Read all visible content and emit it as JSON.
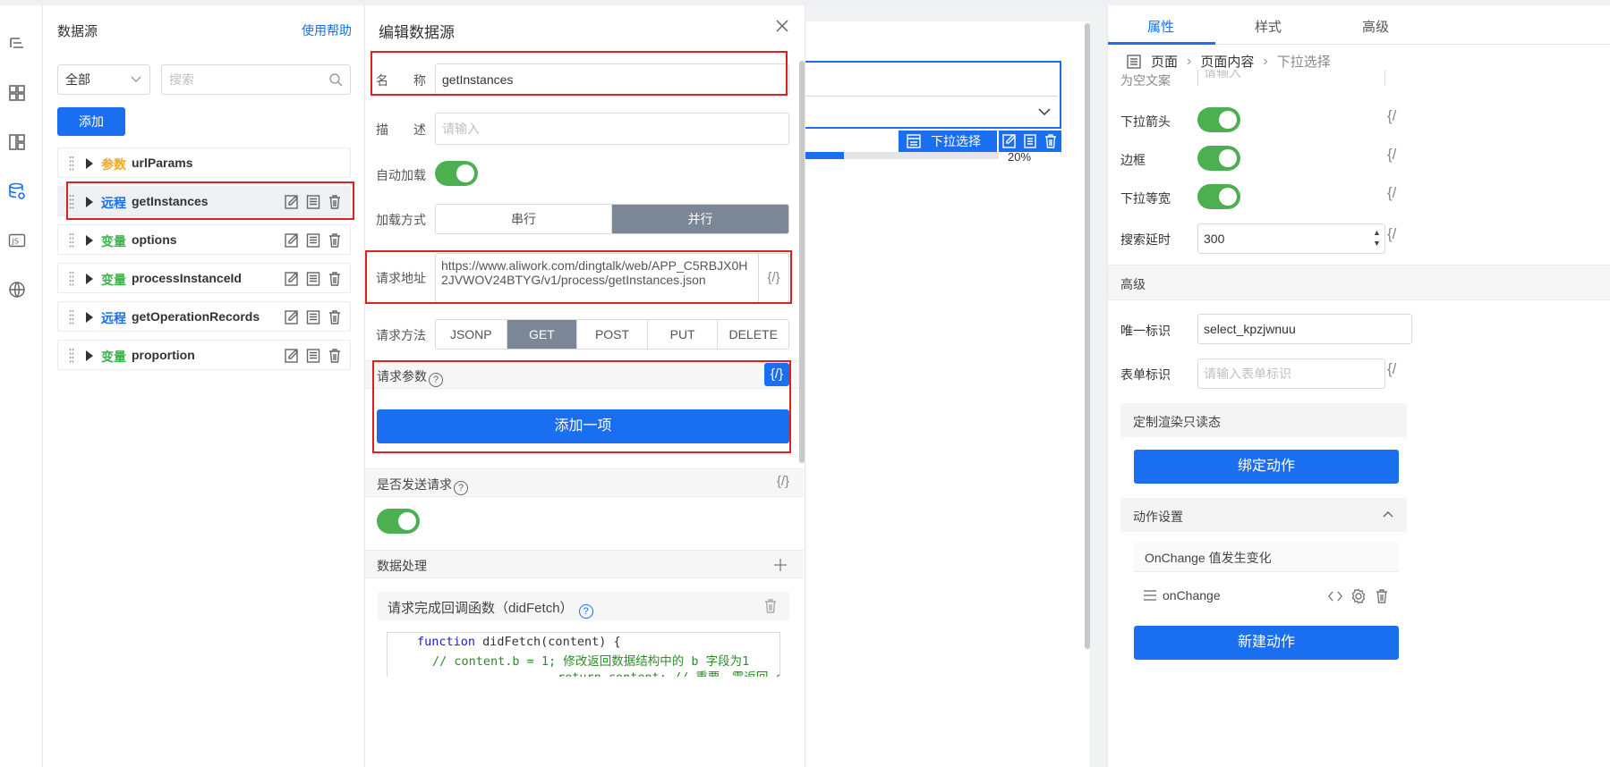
{
  "rail": {
    "icons": [
      "outline-tree-icon",
      "components-icon",
      "layout-icon",
      "datasource-icon",
      "js-icon",
      "globe-icon"
    ]
  },
  "datasource_panel": {
    "title": "数据源",
    "help_link": "使用帮助",
    "filter_value": "全部",
    "search_placeholder": "搜索",
    "add_button": "添加",
    "items": [
      {
        "tag": "参数",
        "kind": "param",
        "name": "urlParams"
      },
      {
        "tag": "远程",
        "kind": "remote",
        "name": "getInstances"
      },
      {
        "tag": "变量",
        "kind": "var",
        "name": "options"
      },
      {
        "tag": "变量",
        "kind": "var",
        "name": "processInstanceId"
      },
      {
        "tag": "远程",
        "kind": "remote",
        "name": "getOperationRecords"
      },
      {
        "tag": "变量",
        "kind": "var",
        "name": "proportion"
      }
    ]
  },
  "editor": {
    "title": "编辑数据源",
    "name_label": "名　　称",
    "name_value": "getInstances",
    "desc_label": "描　　述",
    "desc_placeholder": "请输入",
    "autoload_label": "自动加载",
    "loadmode_label": "加载方式",
    "loadmode_options": [
      "串行",
      "并行"
    ],
    "loadmode_selected": "并行",
    "url_label": "请求地址",
    "url_value": "https://www.aliwork.com/dingtalk/web/APP_C5RBJX0H2JVWOV24BTYG/v1/process/getInstances.json",
    "code_button": "{/}",
    "method_label": "请求方法",
    "methods": [
      "JSONP",
      "GET",
      "POST",
      "PUT",
      "DELETE"
    ],
    "method_selected": "GET",
    "params_label": "请求参数",
    "add_item_button": "添加一项",
    "send_label": "是否发送请求",
    "processing_label": "数据处理",
    "didfetch_label": "请求完成回调函数（didFetch）",
    "code_line1_kw": "function",
    "code_line1": " didFetch(content) {",
    "code_line2": "// content.b = 1; 修改返回数据结构中的 b 字段为1",
    "code_line3": "return content; // 重要，需返回 content"
  },
  "canvas": {
    "component_tag": "下拉选择",
    "progress_text": "20%",
    "progress": 0.2
  },
  "props": {
    "tabs": [
      "属性",
      "样式",
      "高级"
    ],
    "active_tab": "属性",
    "breadcrumb": [
      "页面",
      "页面内容",
      "下拉选择"
    ],
    "empty_text_label": "为空文案",
    "empty_text_placeholder": "请输入",
    "dropdown_arrow_label": "下拉箭头",
    "border_label": "边框",
    "equal_width_label": "下拉等宽",
    "search_delay_label": "搜索延时",
    "search_delay_value": "300",
    "advanced_section": "高级",
    "unique_id_label": "唯一标识",
    "unique_id_value": "select_kpzjwnuu",
    "form_id_label": "表单标识",
    "form_id_placeholder": "请输入表单标识",
    "custom_readonly": "定制渲染只读态",
    "bind_action_button": "绑定动作",
    "action_settings": "动作设置",
    "event_title": "OnChange 值发生变化",
    "event_handler": "onChange",
    "new_action_button": "新建动作",
    "code_button": "{/"
  },
  "colors": {
    "accent": "#1a6ff0",
    "toggle_on": "#4caf50",
    "highlight": "#e0201e",
    "segment_active": "#7b8696"
  }
}
